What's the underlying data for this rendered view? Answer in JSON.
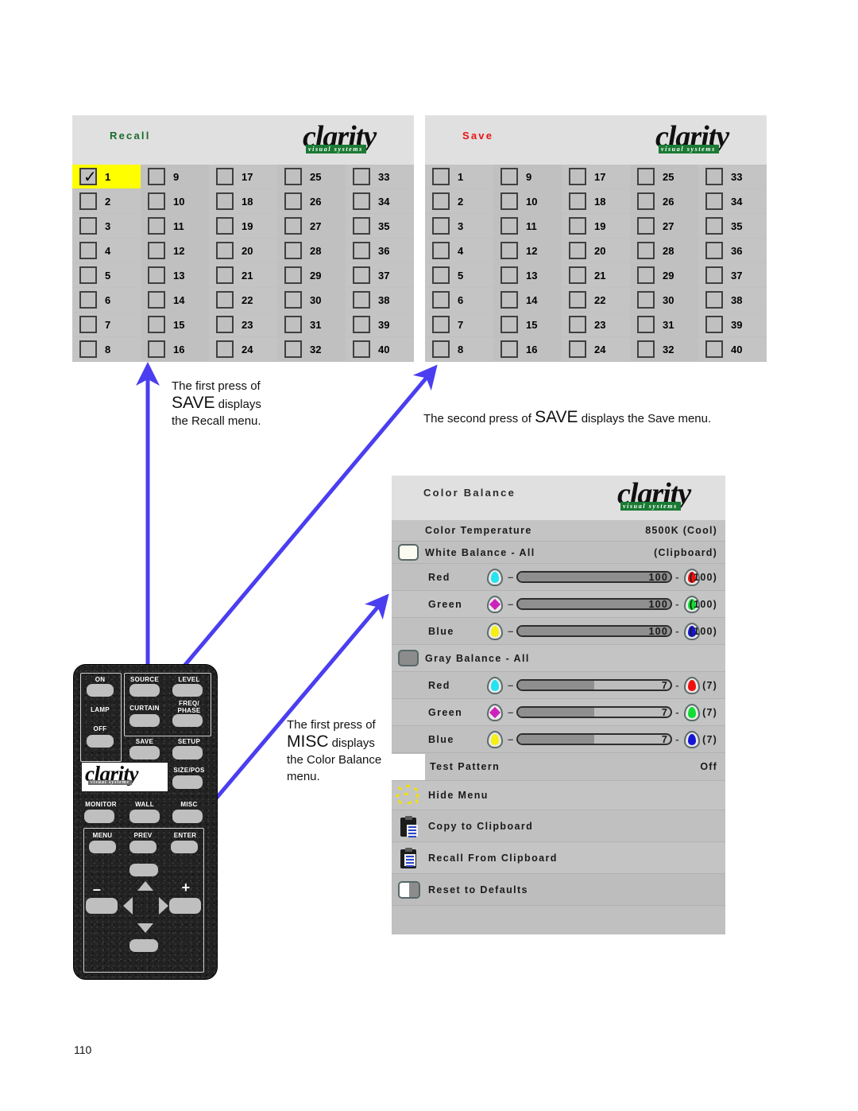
{
  "page": {
    "number": "110"
  },
  "brand": {
    "name": "clarity",
    "tagline": "visual systems",
    "green": "#1a7a34"
  },
  "recall_menu": {
    "title": "Recall",
    "title_color": "#1a6b2a",
    "selected_preset": "1",
    "columns": [
      [
        "1",
        "2",
        "3",
        "4",
        "5",
        "6",
        "7",
        "8"
      ],
      [
        "9",
        "10",
        "11",
        "12",
        "13",
        "14",
        "15",
        "16"
      ],
      [
        "17",
        "18",
        "19",
        "20",
        "21",
        "22",
        "23",
        "24"
      ],
      [
        "25",
        "26",
        "27",
        "28",
        "29",
        "30",
        "31",
        "32"
      ],
      [
        "33",
        "34",
        "35",
        "36",
        "37",
        "38",
        "39",
        "40"
      ]
    ],
    "checkmark": "✓"
  },
  "save_menu": {
    "title": "Save",
    "title_color": "#e81414",
    "columns": [
      [
        "1",
        "2",
        "3",
        "4",
        "5",
        "6",
        "7",
        "8"
      ],
      [
        "9",
        "10",
        "11",
        "12",
        "13",
        "14",
        "15",
        "16"
      ],
      [
        "17",
        "18",
        "19",
        "20",
        "21",
        "22",
        "23",
        "24"
      ],
      [
        "25",
        "26",
        "27",
        "28",
        "29",
        "30",
        "31",
        "32"
      ],
      [
        "33",
        "34",
        "35",
        "36",
        "37",
        "38",
        "39",
        "40"
      ]
    ]
  },
  "color_balance_menu": {
    "title": "Color Balance",
    "rows": {
      "color_temperature": {
        "label": "Color Temperature",
        "value": "8500K (Cool)"
      },
      "white_balance": {
        "label": "White Balance - All",
        "value": "(Clipboard)"
      },
      "white_red": {
        "label": "Red",
        "value": "100",
        "default": "(100)",
        "fill_pct": 100
      },
      "white_green": {
        "label": "Green",
        "value": "100",
        "default": "(100)",
        "fill_pct": 100
      },
      "white_blue": {
        "label": "Blue",
        "value": "100",
        "default": "(100)",
        "fill_pct": 100
      },
      "gray_balance": {
        "label": "Gray Balance - All",
        "value": ""
      },
      "gray_red": {
        "label": "Red",
        "value": "7",
        "default": "(7)",
        "fill_pct": 50
      },
      "gray_green": {
        "label": "Green",
        "value": "7",
        "default": "(7)",
        "fill_pct": 50
      },
      "gray_blue": {
        "label": "Blue",
        "value": "7",
        "default": "(7)",
        "fill_pct": 50
      },
      "test_pattern": {
        "label": "Test Pattern",
        "value": "Off"
      },
      "hide_menu": {
        "label": "Hide Menu",
        "value": ""
      },
      "copy_to_clipboard": {
        "label": "Copy to Clipboard",
        "value": ""
      },
      "recall_from_clipboard": {
        "label": "Recall From Clipboard",
        "value": ""
      },
      "reset_to_defaults": {
        "label": "Reset to Defaults",
        "value": ""
      }
    },
    "dash": "–",
    "colors": {
      "cyan": "#25e3f0",
      "red": "#ee1111",
      "magenta": "#cc22bb",
      "green": "#11dd33",
      "yellow": "#f5ef12",
      "blue": "#1515d8"
    }
  },
  "callouts": {
    "save_first": {
      "line1": "The first press of",
      "big": "SAVE",
      "after": " displays",
      "line3": "the Recall menu."
    },
    "save_second": {
      "before": "The second press of ",
      "big": "SAVE",
      "after": " displays the Save menu."
    },
    "misc_first": {
      "line1": "The first press of",
      "big": "MISC",
      "after": " displays",
      "line3": "the Color Balance",
      "line4": "menu."
    }
  },
  "remote": {
    "brand": "clarity",
    "tagline": "visual systems",
    "buttons": [
      "ON",
      "LAMP",
      "OFF",
      "SOURCE",
      "LEVEL",
      "CURTAIN",
      "FREQ/",
      "PHASE",
      "SAVE",
      "SETUP",
      "SIZE/POS",
      "MONITOR",
      "WALL",
      "MISC",
      "MENU",
      "PREV",
      "ENTER"
    ],
    "minus": "–",
    "plus": "+"
  },
  "arrow_color": "#4a3ef0"
}
